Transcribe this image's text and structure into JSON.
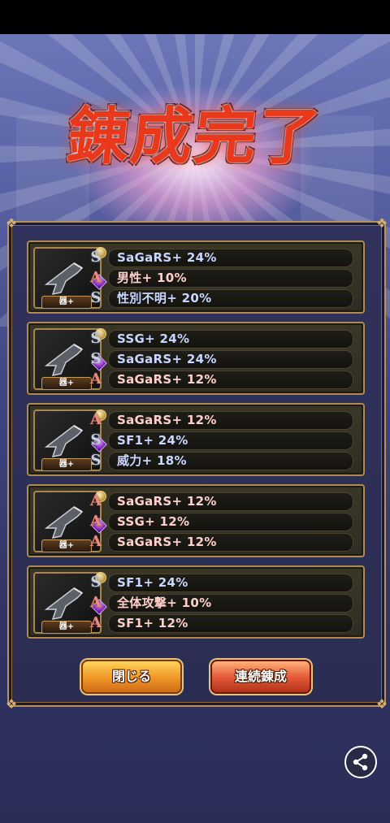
{
  "title": "錬成完了",
  "results": [
    {
      "badge": "器+",
      "stats": [
        {
          "rank": "S",
          "text": "SaGaRS+ 24%"
        },
        {
          "rank": "A",
          "text": "男性+ 10%"
        },
        {
          "rank": "S",
          "text": "性別不明+ 20%"
        }
      ]
    },
    {
      "badge": "器+",
      "stats": [
        {
          "rank": "S",
          "text": "SSG+ 24%"
        },
        {
          "rank": "S",
          "text": "SaGaRS+ 24%"
        },
        {
          "rank": "A",
          "text": "SaGaRS+ 12%"
        }
      ]
    },
    {
      "badge": "器+",
      "stats": [
        {
          "rank": "A",
          "text": "SaGaRS+ 12%"
        },
        {
          "rank": "S",
          "text": "SF1+ 24%"
        },
        {
          "rank": "S",
          "text": "威力+ 18%"
        }
      ]
    },
    {
      "badge": "器+",
      "stats": [
        {
          "rank": "A",
          "text": "SaGaRS+ 12%"
        },
        {
          "rank": "A",
          "text": "SSG+ 12%"
        },
        {
          "rank": "A",
          "text": "SaGaRS+ 12%"
        }
      ]
    },
    {
      "badge": "器+",
      "stats": [
        {
          "rank": "S",
          "text": "SF1+ 24%"
        },
        {
          "rank": "A",
          "text": "全体攻撃+ 10%"
        },
        {
          "rank": "A",
          "text": "SF1+ 12%"
        }
      ]
    }
  ],
  "buttons": {
    "close": "閉じる",
    "again": "連続錬成"
  },
  "icons": {
    "share": "share-icon"
  }
}
